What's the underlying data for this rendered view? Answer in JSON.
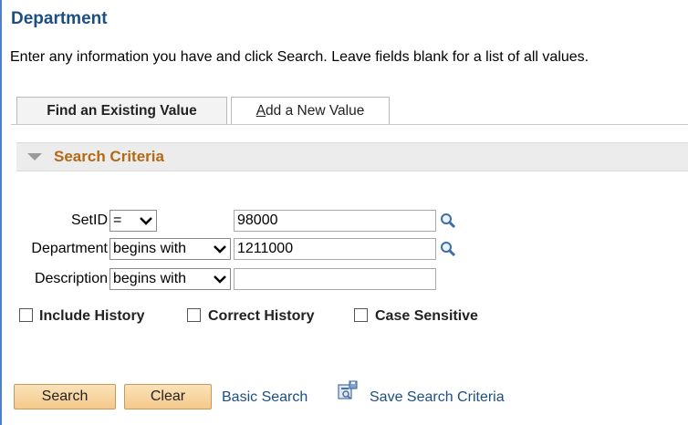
{
  "page": {
    "title": "Department",
    "instructions": "Enter any information you have and click Search. Leave fields blank for a list of all values."
  },
  "tabs": [
    {
      "label": "Find an Existing Value",
      "active": true
    },
    {
      "label_accesskey": "A",
      "label_rest": "dd a New Value",
      "active": false
    }
  ],
  "search_criteria": {
    "title": "Search Criteria",
    "fields": [
      {
        "label": "SetID",
        "operator": "=",
        "value": ""
      },
      {
        "label": "Department",
        "operator": "begins with",
        "value": ""
      },
      {
        "label": "Description",
        "operator": "begins with",
        "value": ""
      }
    ],
    "setid_value": "98000",
    "department_value": "1211000",
    "description_value": ""
  },
  "checkboxes": [
    {
      "label": "Include History",
      "checked": false
    },
    {
      "label": "Correct History",
      "checked": false
    },
    {
      "label": "Case Sensitive",
      "checked": false
    }
  ],
  "actions": {
    "search_label": "Search",
    "clear_label": "Clear",
    "basic_search_label": "Basic Search",
    "save_search_label": "Save Search Criteria"
  },
  "icons": {
    "lookup": "magnifier-icon",
    "save_search": "save-search-icon",
    "collapse": "triangle-down-icon",
    "dropdown": "chevron-down-icon"
  },
  "colors": {
    "title": "#1c4e86",
    "section_title": "#b36a15",
    "button_bg": "#f4c98b",
    "link": "#1c4e86"
  }
}
